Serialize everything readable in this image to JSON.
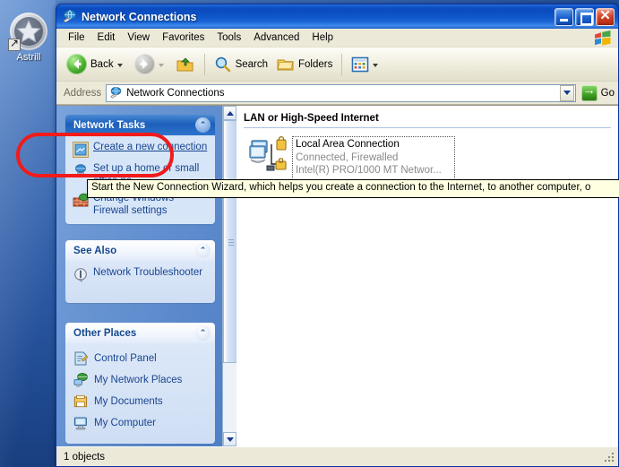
{
  "desktop": {
    "icon": {
      "label": "Astrill",
      "name": "astrill-shortcut"
    },
    "background_color": "#2c5ba6"
  },
  "window": {
    "title": "Network Connections",
    "icon": "network-connections-icon",
    "controls": {
      "minimize": "_",
      "maximize": "□",
      "close": "✕"
    }
  },
  "menubar": {
    "items": [
      "File",
      "Edit",
      "View",
      "Favorites",
      "Tools",
      "Advanced",
      "Help"
    ],
    "logo": "windows-flag-logo"
  },
  "toolbar": {
    "back": "Back",
    "forward": "",
    "up": "",
    "search": "Search",
    "folders": "Folders",
    "views": ""
  },
  "address": {
    "label": "Address",
    "value": "Network Connections",
    "go": "Go"
  },
  "task_panes": [
    {
      "title": "Network Tasks",
      "style": "blue",
      "items": [
        {
          "label": "Create a new connection",
          "icon": "new-connection-icon",
          "link": true
        },
        {
          "label": "Set up a home or small office ne",
          "icon": "home-network-icon",
          "link": false
        },
        {
          "label": "Change Windows Firewall settings",
          "icon": "firewall-icon",
          "link": false
        }
      ]
    },
    {
      "title": "See Also",
      "style": "white",
      "items": [
        {
          "label": "Network Troubleshooter",
          "icon": "info-icon",
          "link": false
        }
      ]
    },
    {
      "title": "Other Places",
      "style": "white",
      "items": [
        {
          "label": "Control Panel",
          "icon": "control-panel-icon",
          "link": false
        },
        {
          "label": "My Network Places",
          "icon": "my-network-places-icon",
          "link": false
        },
        {
          "label": "My Documents",
          "icon": "my-documents-icon",
          "link": false
        },
        {
          "label": "My Computer",
          "icon": "my-computer-icon",
          "link": false
        }
      ]
    }
  ],
  "content": {
    "group_header": "LAN or High-Speed Internet",
    "connections": [
      {
        "name": "Local Area Connection",
        "status": "Connected, Firewalled",
        "device": "Intel(R) PRO/1000 MT Networ...",
        "icon": "lan-connection-firewalled-icon"
      }
    ]
  },
  "tooltip": {
    "text": "Start the New Connection Wizard, which helps you create a connection to the Internet, to another computer, o"
  },
  "statusbar": {
    "text": "1 objects"
  },
  "annotation": {
    "shape": "red-oval-highlight",
    "target": "Create a new connection",
    "color": "#f21a1a"
  }
}
